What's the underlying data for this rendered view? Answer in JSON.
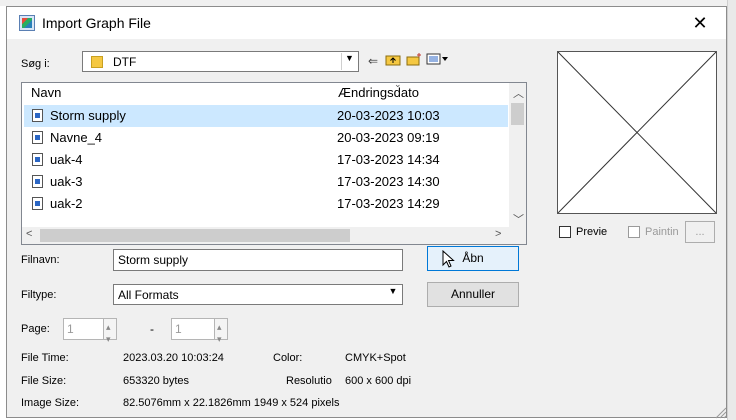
{
  "dialog": {
    "title": "Import Graph File",
    "close_glyph": "✕"
  },
  "lookin": {
    "label": "Søg i:",
    "value": "DTF"
  },
  "filelist": {
    "columns": [
      "Navn",
      "Ændringsdato"
    ],
    "rows": [
      {
        "name": "Storm supply",
        "date": "20-03-2023 10:03",
        "selected": true
      },
      {
        "name": "Navne_4",
        "date": "20-03-2023 09:19"
      },
      {
        "name": "uak-4",
        "date": "17-03-2023 14:34"
      },
      {
        "name": "uak-3",
        "date": "17-03-2023 14:30"
      },
      {
        "name": "uak-2",
        "date": "17-03-2023 14:29"
      }
    ]
  },
  "preview": {
    "preview_label": "Previe",
    "painting_label": "Paintin",
    "more_label": "..."
  },
  "filename": {
    "label": "Filnavn:",
    "value": "Storm supply"
  },
  "filetype": {
    "label": "Filtype:",
    "value": "All Formats"
  },
  "buttons": {
    "open": "Åbn",
    "cancel": "Annuller"
  },
  "page": {
    "label": "Page:",
    "from": "1",
    "dash": "-",
    "to": "1"
  },
  "info": {
    "file_time_label": "File Time:",
    "file_time": "2023.03.20 10:03:24",
    "color_label": "Color:",
    "color": "CMYK+Spot",
    "file_size_label": "File Size:",
    "file_size": "653320 bytes",
    "resolution_label": "Resolutio",
    "resolution": "600 x 600 dpi",
    "image_size_label": "Image Size:",
    "image_size": "82.5076mm x 22.1826mm  1949 x 524 pixels"
  },
  "icons": [
    "app-icon",
    "close-icon",
    "folder-icon",
    "dropdown-arrow-icon",
    "back-icon",
    "up-folder-icon",
    "new-folder-icon",
    "view-menu-icon",
    "file-icon",
    "scroll-up-icon",
    "scroll-down-icon",
    "scroll-left-icon",
    "scroll-right-icon",
    "mouse-cursor-icon",
    "resize-grip-icon"
  ],
  "colors": {
    "selection": "#cce8ff",
    "dialog_bg": "#f0f0f0",
    "default_button_border": "#0078d7"
  }
}
